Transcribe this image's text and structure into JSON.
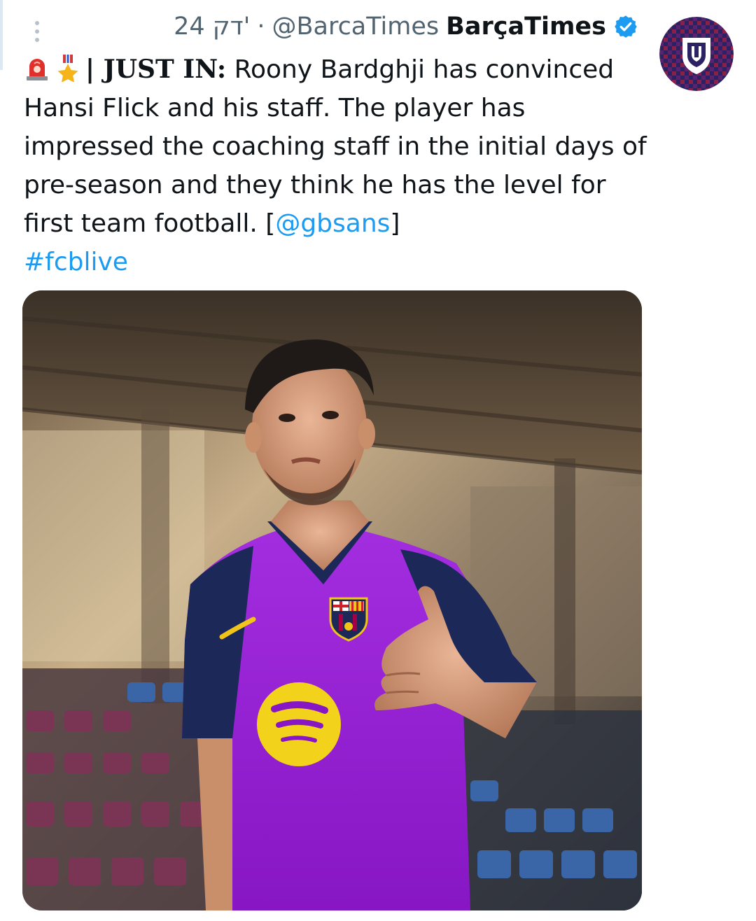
{
  "tweet": {
    "time": "24 דק'",
    "separator": "·",
    "handle": "@BarcaTimes",
    "display_name": "BarçaTimes",
    "verified": true,
    "emoji_1": "siren-emoji",
    "emoji_2": "medal-emoji",
    "lead": "| JUST IN:",
    "text": " Roony Bardghji has convinced Hansi Flick and his staff. The player has impressed the coaching staff in the initial days of pre-season and they think he has the level for first team football. [",
    "mention": "@gbsans",
    "text_end": "]",
    "hashtag": "#fcblive",
    "more_icon": "more-vertical-icon",
    "avatar_icon": "barcatimes-logo",
    "media_description_icon": "player-photo"
  },
  "colors": {
    "link": "#1d9bf0",
    "secondary_text": "#536471",
    "verified": "#1d9bf0",
    "shirt_purple": "#9b1fd6",
    "shirt_navy": "#1c2857",
    "sponsor_yellow": "#f2d21a",
    "avatar_bg": "#2a2262"
  }
}
